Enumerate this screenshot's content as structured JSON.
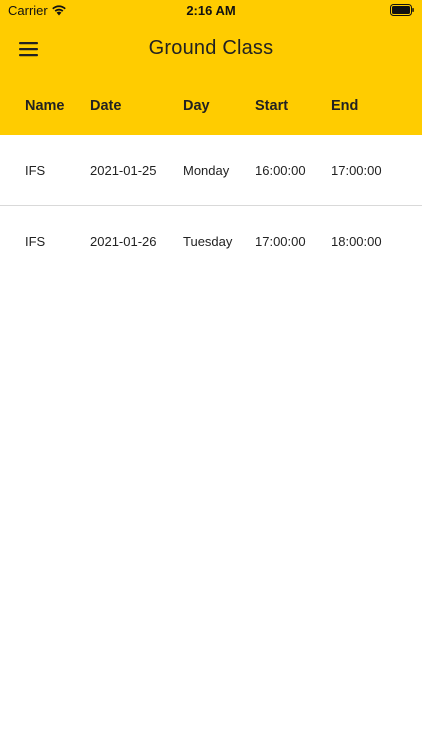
{
  "status_bar": {
    "carrier": "Carrier",
    "time": "2:16 AM"
  },
  "header": {
    "title": "Ground Class",
    "background_color": "#FFCC00",
    "menu_icon": "hamburger-menu-icon"
  },
  "table": {
    "columns": [
      "Name",
      "Date",
      "Day",
      "Start",
      "End"
    ],
    "rows": [
      [
        "IFS",
        "2021-01-25",
        "Monday",
        "16:00:00",
        "17:00:00"
      ],
      [
        "IFS",
        "2021-01-26",
        "Tuesday",
        "17:00:00",
        "18:00:00"
      ]
    ]
  }
}
